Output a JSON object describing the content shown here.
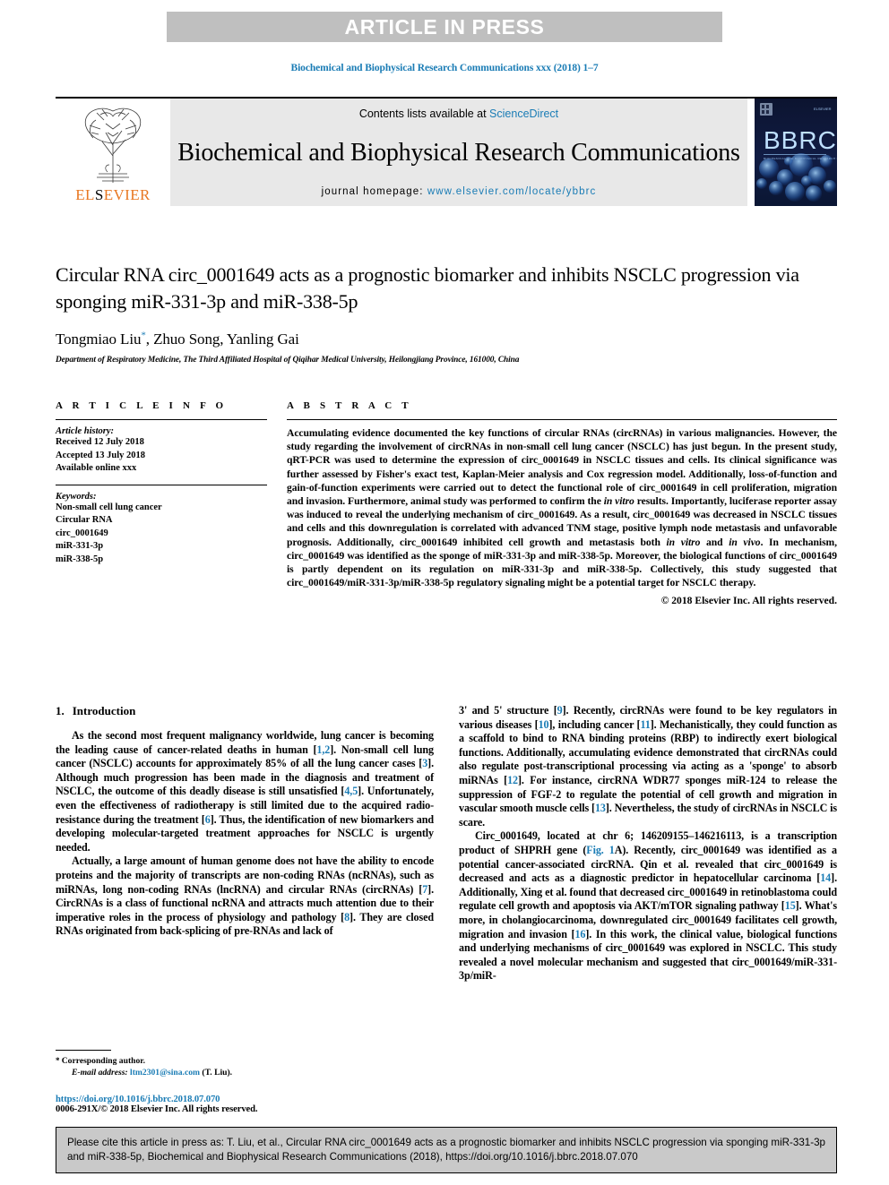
{
  "banner": {
    "text": "ARTICLE IN PRESS"
  },
  "journal_ref": "Biochemical and Biophysical Research Communications xxx (2018) 1–7",
  "masthead": {
    "publisher": "ELSEVIER",
    "contents_prefix": "Contents lists available at ",
    "contents_link": "ScienceDirect",
    "journal_title": "Biochemical and Biophysical Research Communications",
    "homepage_prefix": "journal homepage: ",
    "homepage_url": "www.elsevier.com/locate/ybbrc",
    "cover_label": "BBRC",
    "cover_subtitle": "BIOCHEMICAL AND BIOPHYSICAL RESEARCH COMMUNICATIONS",
    "accent_color": "#1a7cb5",
    "elsevier_orange": "#e87722"
  },
  "article": {
    "title": "Circular RNA circ_0001649 acts as a prognostic biomarker and inhibits NSCLC progression via sponging miR-331-3p and miR-338-5p",
    "authors": "Tongmiao Liu, Zhuo Song, Yanling Gai",
    "author_marker": "*",
    "affiliation": "Department of Respiratory Medicine, The Third Affiliated Hospital of Qiqihar Medical University, Heilongjiang Province, 161000, China"
  },
  "article_info": {
    "heading": "A R T I C L E   I N F O",
    "history_label": "Article history:",
    "history": [
      "Received 12 July 2018",
      "Accepted 13 July 2018",
      "Available online xxx"
    ],
    "keywords_label": "Keywords:",
    "keywords": [
      "Non-small cell lung cancer",
      "Circular RNA",
      "circ_0001649",
      "miR-331-3p",
      "miR-338-5p"
    ]
  },
  "abstract": {
    "heading": "A B S T R A C T",
    "paragraphs": [
      "Accumulating evidence documented the key functions of circular RNAs (circRNAs) in various malignancies. However, the study regarding the involvement of circRNAs in non-small cell lung cancer (NSCLC) has just begun. In the present study, qRT-PCR was used to determine the expression of circ_0001649 in NSCLC tissues and cells. Its clinical significance was further assessed by Fisher's exact test, Kaplan-Meier analysis and Cox regression model. Additionally, loss-of-function and gain-of-function experiments were carried out to detect the functional role of circ_0001649 in cell proliferation, migration and invasion. Furthermore, animal study was performed to confirm the in vitro results. Importantly, luciferase reporter assay was induced to reveal the underlying mechanism of circ_0001649. As a result, circ_0001649 was decreased in NSCLC tissues and cells and this downregulation is correlated with advanced TNM stage, positive lymph node metastasis and unfavorable prognosis. Additionally, circ_0001649 inhibited cell growth and metastasis both in vitro and in vivo. In mechanism, circ_0001649 was identified as the sponge of miR-331-3p and miR-338-5p. Moreover, the biological functions of circ_0001649 is partly dependent on its regulation on miR-331-3p and miR-338-5p. Collectively, this study suggested that circ_0001649/miR-331-3p/miR-338-5p regulatory signaling might be a potential target for NSCLC therapy."
    ],
    "copyright": "© 2018 Elsevier Inc. All rights reserved."
  },
  "introduction": {
    "number": "1.",
    "title": "Introduction",
    "left_paragraphs": [
      "As the second most frequent malignancy worldwide, lung cancer is becoming the leading cause of cancer-related deaths in human [1,2]. Non-small cell lung cancer (NSCLC) accounts for approximately 85% of all the lung cancer cases [3]. Although much progression has been made in the diagnosis and treatment of NSCLC, the outcome of this deadly disease is still unsatisfied [4,5]. Unfortunately, even the effectiveness of radiotherapy is still limited due to the acquired radio-resistance during the treatment [6]. Thus, the identification of new biomarkers and developing molecular-targeted treatment approaches for NSCLC is urgently needed.",
      "Actually, a large amount of human genome does not have the ability to encode proteins and the majority of transcripts are non-coding RNAs (ncRNAs), such as miRNAs, long non-coding RNAs (lncRNA) and circular RNAs (circRNAs) [7]. CircRNAs is a class of functional ncRNA and attracts much attention due to their imperative roles in the process of physiology and pathology [8]. They are closed RNAs originated from back-splicing of pre-RNAs and lack of"
    ],
    "right_paragraphs": [
      "3' and 5' structure [9]. Recently, circRNAs were found to be key regulators in various diseases [10], including cancer [11]. Mechanistically, they could function as a scaffold to bind to RNA binding proteins (RBP) to indirectly exert biological functions. Additionally, accumulating evidence demonstrated that circRNAs could also regulate post-transcriptional processing via acting as a 'sponge' to absorb miRNAs [12]. For instance, circRNA WDR77 sponges miR-124 to release the suppression of FGF-2 to regulate the potential of cell growth and migration in vascular smooth muscle cells [13]. Nevertheless, the study of circRNAs in NSCLC is scare.",
      "Circ_0001649, located at chr 6; 146209155–146216113, is a transcription product of SHPRH gene (Fig. 1A). Recently, circ_0001649 was identified as a potential cancer-associated circRNA. Qin et al. revealed that circ_0001649 is decreased and acts as a diagnostic predictor in hepatocellular carcinoma [14]. Additionally, Xing et al. found that decreased circ_0001649 in retinoblastoma could regulate cell growth and apoptosis via AKT/mTOR signaling pathway [15]. What's more, in cholangiocarcinoma, downregulated circ_0001649 facilitates cell growth, migration and invasion [16]. In this work, the clinical value, biological functions and underlying mechanisms of circ_0001649 was explored in NSCLC. This study revealed a novel molecular mechanism and suggested that circ_0001649/miR-331-3p/miR-"
    ]
  },
  "footnote": {
    "corresponding": "Corresponding author.",
    "email_label": "E-mail address:",
    "email": "ltm2301@sina.com",
    "email_suffix": "(T. Liu).",
    "doi": "https://doi.org/10.1016/j.bbrc.2018.07.070",
    "issn": "0006-291X/© 2018 Elsevier Inc. All rights reserved."
  },
  "citation_box": {
    "text": "Please cite this article in press as: T. Liu, et al., Circular RNA circ_0001649 acts as a prognostic biomarker and inhibits NSCLC progression via sponging miR-331-3p and miR-338-5p, Biochemical and Biophysical Research Communications (2018), https://doi.org/10.1016/j.bbrc.2018.07.070"
  }
}
